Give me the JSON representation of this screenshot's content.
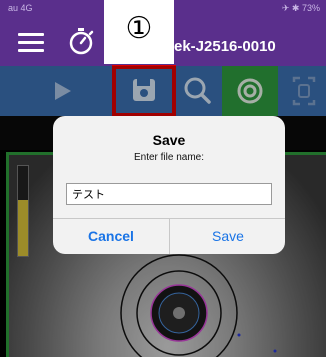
{
  "status_bar": {
    "carrier": "au  4G",
    "right": "✈ ✱ 73%"
  },
  "header": {
    "title": "ek-J2516-0010"
  },
  "callout": {
    "label": "①"
  },
  "toolbar": {
    "buttons": [
      "play-icon",
      "save-icon",
      "search-icon",
      "target-icon",
      "frame-icon"
    ],
    "highlight_color": "#e00000",
    "active_color": "#2f9a3f"
  },
  "camera": {
    "focus_level": 0.62
  },
  "dialog": {
    "title": "Save",
    "message": "Enter file name:",
    "filename_value": "テスト",
    "cancel_label": "Cancel",
    "save_label": "Save"
  },
  "colors": {
    "header": "#5a2f8c",
    "toolbar": "#3b6fb0",
    "link": "#1a74e6"
  }
}
